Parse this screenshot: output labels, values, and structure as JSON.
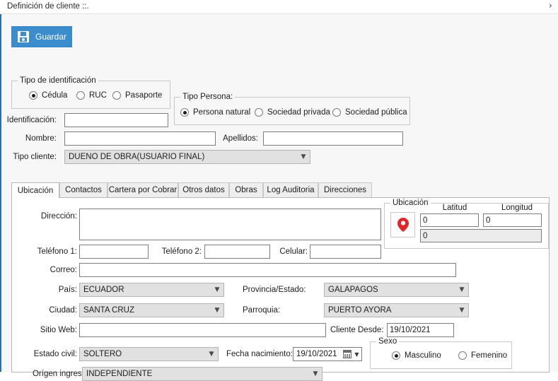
{
  "header": {
    "title": "Definición de cliente ::.",
    "expand_icon": "chevron-right-icon"
  },
  "toolbar": {
    "save_label": "Guardar",
    "save_icon": "floppy-disk-icon",
    "save_color": "#3c8dcd"
  },
  "identification_group": {
    "title": "Tipo de identificación",
    "options": [
      {
        "label": "Cédula",
        "selected": true
      },
      {
        "label": "RUC",
        "selected": false
      },
      {
        "label": "Pasaporte",
        "selected": false
      }
    ]
  },
  "person_type_group": {
    "title": "Tipo Persona:",
    "options": [
      {
        "label": "Persona natural",
        "selected": true
      },
      {
        "label": "Sociedad privada",
        "selected": false
      },
      {
        "label": "Sociedad pública",
        "selected": false
      }
    ]
  },
  "top_form": {
    "identificacion_label": "Identificación:",
    "identificacion_value": "",
    "nombre_label": "Nombre:",
    "nombre_value": "",
    "apellidos_label": "Apellidos:",
    "apellidos_value": "",
    "tipo_cliente_label": "Tipo cliente:",
    "tipo_cliente_value": "DUENO DE OBRA(USUARIO FINAL)"
  },
  "tabs": [
    {
      "label": "Ubicación",
      "active": true
    },
    {
      "label": "Contactos",
      "active": false
    },
    {
      "label": "Cartera por Cobrar",
      "active": false
    },
    {
      "label": "Otros datos",
      "active": false
    },
    {
      "label": "Obras",
      "active": false
    },
    {
      "label": "Log Auditoria",
      "active": false
    },
    {
      "label": "Direcciones",
      "active": false
    }
  ],
  "ubicacion_tab": {
    "direccion_label": "Dirección:",
    "direccion_value": "",
    "telefono1_label": "Teléfono 1:",
    "telefono1_value": "",
    "telefono2_label": "Teléfono 2:",
    "telefono2_value": "",
    "celular_label": "Celular:",
    "celular_value": "",
    "correo_label": "Correo:",
    "correo_value": "",
    "pais_label": "País:",
    "pais_value": "ECUADOR",
    "provincia_label": "Provincia/Estado:",
    "provincia_value": "GALAPAGOS",
    "ciudad_label": "Ciudad:",
    "ciudad_value": "SANTA CRUZ",
    "parroquia_label": "Parroquia:",
    "parroquia_value": "PUERTO AYORA",
    "sitio_web_label": "Sitio Web:",
    "sitio_web_value": "",
    "cliente_desde_label": "Cliente Desde:",
    "cliente_desde_value": "19/10/2021",
    "estado_civil_label": "Estado civil:",
    "estado_civil_value": "SOLTERO",
    "fecha_nacimiento_label": "Fecha nacimiento:",
    "fecha_nacimiento_value": "19/10/2021",
    "origen_ingresos_label": "Orígen ingresos:",
    "origen_ingresos_value": "INDEPENDIENTE"
  },
  "location_group": {
    "title": "Ubicación",
    "pin_icon": "map-pin-icon",
    "pin_color": "#e02626",
    "latitud_label": "Latitud",
    "latitud_value": "0",
    "longitud_label": "Longitud",
    "longitud_value": "0",
    "address_readonly_value": "0"
  },
  "sexo_group": {
    "title": "Sexo",
    "options": [
      {
        "label": "Masculino",
        "selected": true
      },
      {
        "label": "Femenino",
        "selected": false
      }
    ]
  }
}
